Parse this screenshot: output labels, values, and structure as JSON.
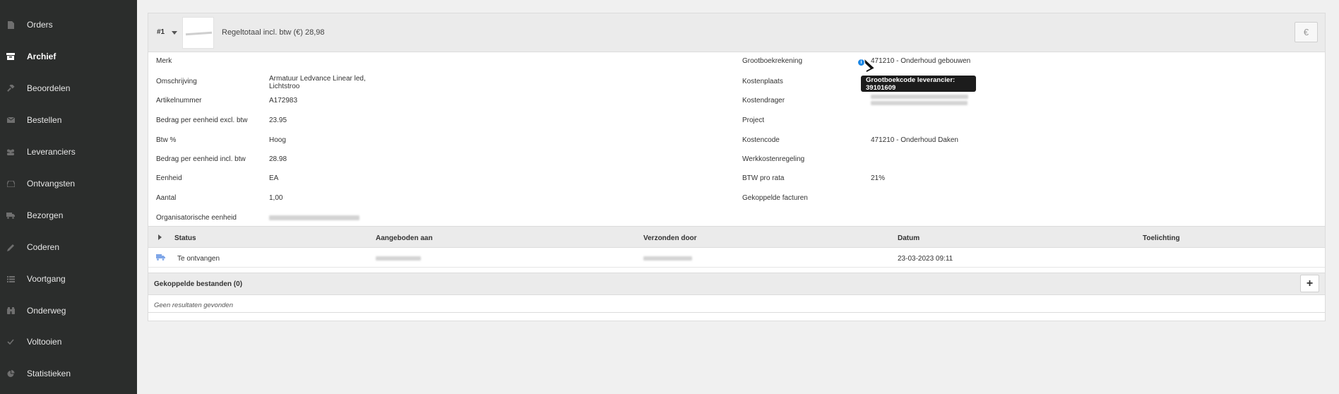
{
  "sidebar": {
    "items": [
      {
        "label": "Orders",
        "icon": "file-icon"
      },
      {
        "label": "Archief",
        "icon": "archive-icon",
        "active": true
      },
      {
        "label": "Beoordelen",
        "icon": "gavel-icon"
      },
      {
        "label": "Bestellen",
        "icon": "envelope-icon"
      },
      {
        "label": "Leveranciers",
        "icon": "users-icon"
      },
      {
        "label": "Ontvangsten",
        "icon": "inbox-icon"
      },
      {
        "label": "Bezorgen",
        "icon": "truck-icon"
      },
      {
        "label": "Coderen",
        "icon": "pencil-icon"
      },
      {
        "label": "Voortgang",
        "icon": "list-icon"
      },
      {
        "label": "Onderweg",
        "icon": "binoculars-icon"
      },
      {
        "label": "Voltooien",
        "icon": "check-icon"
      },
      {
        "label": "Statistieken",
        "icon": "pie-chart-icon"
      }
    ]
  },
  "line": {
    "number": "#1",
    "total": "Regeltotaal incl. btw (€) 28,98",
    "currency_button": "€"
  },
  "fields_left": [
    {
      "label": "Merk",
      "value": ""
    },
    {
      "label": "Omschrijving",
      "value": "Armatuur Ledvance Linear led,\nLichtstroo"
    },
    {
      "label": "Artikelnummer",
      "value": "A172983"
    },
    {
      "label": "Bedrag per eenheid excl. btw",
      "value": "23.95"
    },
    {
      "label": "Btw %",
      "value": "Hoog"
    },
    {
      "label": "Bedrag per eenheid incl. btw",
      "value": "28.98"
    },
    {
      "label": "Eenheid",
      "value": "EA"
    },
    {
      "label": "Aantal",
      "value": "1,00"
    },
    {
      "label": "Organisatorische eenheid",
      "value": ""
    }
  ],
  "fields_right": [
    {
      "label": "Grootboekrekening",
      "value": "471210 - Onderhoud gebouwen"
    },
    {
      "label": "Kostenplaats",
      "value": ""
    },
    {
      "label": "Kostendrager",
      "value": ""
    },
    {
      "label": "Project",
      "value": ""
    },
    {
      "label": "Kostencode",
      "value": "471210 - Onderhoud Daken"
    },
    {
      "label": "Werkkostenregeling",
      "value": ""
    },
    {
      "label": "BTW pro rata",
      "value": "21%"
    },
    {
      "label": "Gekoppelde facturen",
      "value": ""
    }
  ],
  "tooltip": {
    "text": "Grootboekcode leverancier: 39101609"
  },
  "status_table": {
    "headers": [
      "Status",
      "Aangeboden aan",
      "Verzonden door",
      "Datum",
      "Toelichting"
    ],
    "rows": [
      {
        "status": "Te ontvangen",
        "aangeboden_aan": "",
        "verzonden_door": "",
        "datum": "23-03-2023 09:11",
        "toelichting": ""
      }
    ]
  },
  "files": {
    "title": "Gekoppelde bestanden (0)",
    "empty": "Geen resultaten gevonden",
    "add_label": "+"
  }
}
